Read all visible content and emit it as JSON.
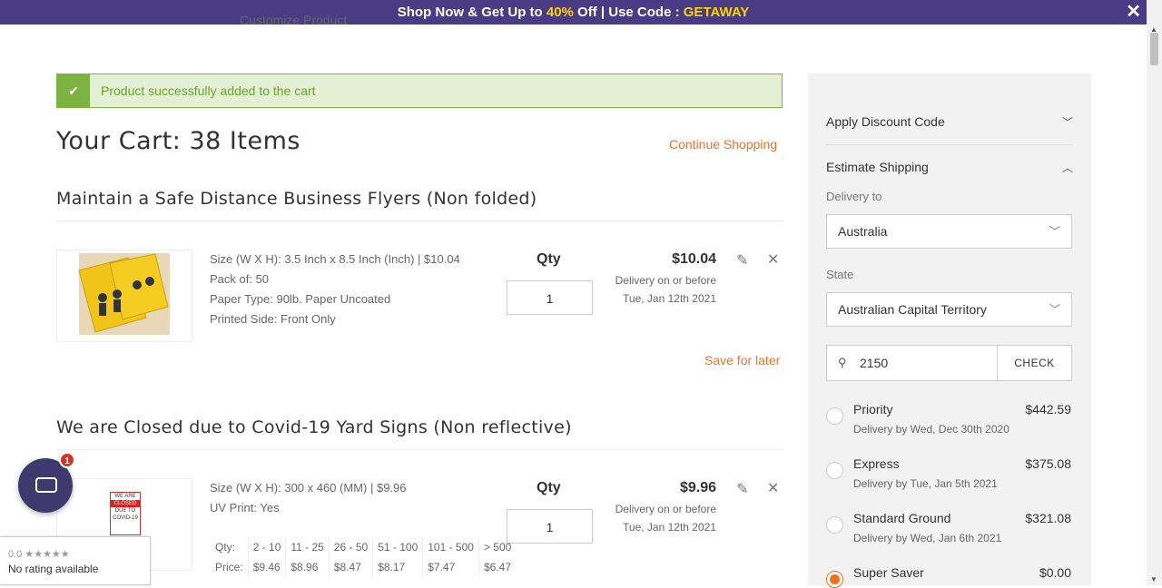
{
  "promo": {
    "text_a": "Shop Now & Get Up to ",
    "highlight_a": "40%",
    "text_b": " Off | Use Code : ",
    "highlight_b": "GETAWAY",
    "close": "✕"
  },
  "cutoff_text": "Customize Product",
  "alert": {
    "message": "Product successfully added to the cart"
  },
  "cart": {
    "title": "Your Cart: 38 Items",
    "continue": "Continue Shopping"
  },
  "items": [
    {
      "title": "Maintain a Safe Distance Business Flyers (Non folded)",
      "details": [
        "Size (W X H): 3.5 Inch x 8.5 Inch (Inch) | $10.04",
        "Pack of: 50",
        "Paper Type: 90lb. Paper Uncoated",
        "Printed Side: Front Only"
      ],
      "qty_label": "Qty",
      "qty": "1",
      "price": "$10.04",
      "delivery_line1": "Delivery on or before",
      "delivery_line2": "Tue, Jan 12th 2021",
      "save_later": "Save for later"
    },
    {
      "title": "We are Closed due to Covid-19 Yard Signs (Non reflective)",
      "details": [
        "Size (W X H): 300 x 460 (MM) | $9.96",
        "UV Print: Yes"
      ],
      "qty_label": "Qty",
      "qty": "1",
      "price": "$9.96",
      "delivery_line1": "Delivery on or before",
      "delivery_line2": "Tue, Jan 12th 2021",
      "sign_text": [
        "WE ARE",
        "CLOSED",
        "DUE TO",
        "COVID-19"
      ],
      "tiers": {
        "qty_label": "Qty:",
        "price_label": "Price:",
        "ranges": [
          "2 - 10",
          "11 - 25",
          "26 - 50",
          "51 - 100",
          "101 - 500",
          "> 500"
        ],
        "prices": [
          "$9.46",
          "$8.96",
          "$8.47",
          "$8.17",
          "$7.47",
          "$6.47"
        ]
      }
    }
  ],
  "sidebar": {
    "discount": "Apply Discount Code",
    "estimate": "Estimate Shipping",
    "delivery_to_label": "Delivery to",
    "country": "Australia",
    "state_label": "State",
    "state": "Australian Capital Territory",
    "zip": "2150",
    "check": "CHECK",
    "options": [
      {
        "name": "Priority",
        "cost": "$442.59",
        "by": "Delivery by Wed, Dec 30th 2020",
        "selected": false
      },
      {
        "name": "Express",
        "cost": "$375.08",
        "by": "Delivery by Tue, Jan 5th 2021",
        "selected": false
      },
      {
        "name": "Standard Ground",
        "cost": "$321.08",
        "by": "Delivery by Wed, Jan 6th 2021",
        "selected": false
      },
      {
        "name": "Super Saver",
        "cost": "$0.00",
        "by": "",
        "selected": true
      }
    ]
  },
  "chat": {
    "badge": "1"
  },
  "rating": {
    "score": "0.0 ★★★★★",
    "text": "No rating available"
  },
  "colors": {
    "accent": "#f37021",
    "promo_bg": "#4a3b85",
    "promo_highlight": "#ffd400",
    "success": "#7cb342"
  }
}
